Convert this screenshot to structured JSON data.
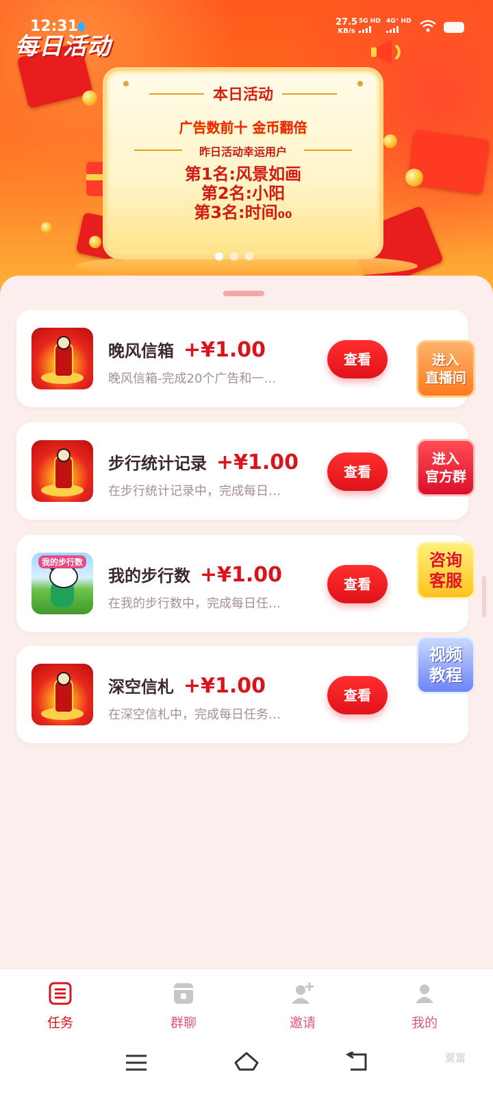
{
  "status_bar": {
    "time": "12:31",
    "net_speed_value": "27.5",
    "net_speed_unit": "KB/s",
    "signal_1": "5G HD",
    "signal_2": "4G⁺ HD"
  },
  "page": {
    "title": "每日活动"
  },
  "banner": {
    "heading": "本日活动",
    "subtitle": "广告数前十 金币翻倍",
    "winners_heading": "昨日活动幸运用户",
    "winners": [
      "第1名:风景如画",
      "第2名:小阳",
      "第3名:时间₀₀"
    ],
    "slide_count": 3,
    "active_slide": 0
  },
  "tasks": [
    {
      "title": "晚风信箱",
      "reward": "+¥1.00",
      "desc": "晚风信箱-完成20个广告和一…",
      "button": "查看",
      "thumb": "red-fortune-figure"
    },
    {
      "title": "步行统计记录",
      "reward": "+¥1.00",
      "desc": "在步行统计记录中，完成每日…",
      "button": "查看",
      "thumb": "red-fortune-figure"
    },
    {
      "title": "我的步行数",
      "reward": "+¥1.00",
      "desc": "在我的步行数中，完成每日任…",
      "button": "查看",
      "thumb": "panda-runner",
      "thumb_tag": "我的步行数"
    },
    {
      "title": "深空信札",
      "reward": "+¥1.00",
      "desc": "在深空信札中，完成每日任务…",
      "button": "查看",
      "thumb": "red-fortune-figure"
    }
  ],
  "floating_buttons": {
    "live": "进入\n直播间",
    "group": "进入\n官方群",
    "service": "咨询\n客服",
    "tutorial": "视频\n教程"
  },
  "tabbar": {
    "items": [
      {
        "label": "任务",
        "icon": "task-list-icon",
        "active": true
      },
      {
        "label": "群聊",
        "icon": "group-chat-icon",
        "active": false
      },
      {
        "label": "邀请",
        "icon": "invite-user-icon",
        "active": false
      },
      {
        "label": "我的",
        "icon": "profile-icon",
        "active": false
      }
    ],
    "active_color": "#d8151c",
    "inactive_color": "#e2567a"
  },
  "watermark": "莫富"
}
